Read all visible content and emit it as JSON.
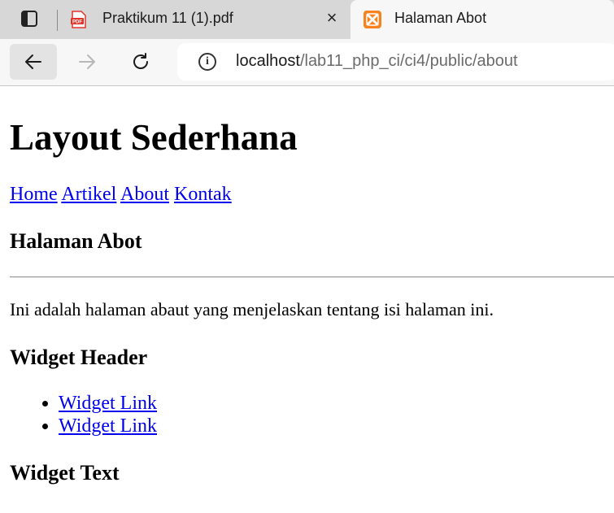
{
  "browser": {
    "tabs": [
      {
        "title": "Praktikum 11 (1).pdf",
        "icon": "pdf-icon",
        "close": "×"
      },
      {
        "title": "Halaman Abot",
        "icon": "xampp-icon"
      }
    ],
    "address": {
      "host": "localhost",
      "path": "/lab11_php_ci/ci4/public/about",
      "info": "i"
    }
  },
  "page": {
    "title": "Layout Sederhana",
    "menu": [
      "Home",
      "Artikel",
      "About",
      "Kontak"
    ],
    "heading": "Halaman Abot",
    "text": "Ini adalah halaman abaut yang menjelaskan tentang isi halaman ini.",
    "widget_header": "Widget Header",
    "widget_links": [
      "Widget Link",
      "Widget Link"
    ],
    "widget_text_heading": "Widget Text"
  },
  "colors": {
    "link": "#0000ee",
    "tabbar": "#d7d7d7",
    "active_tab": "#f7f7f7",
    "xampp": "#f7821e",
    "pdf": "#e0352b"
  }
}
